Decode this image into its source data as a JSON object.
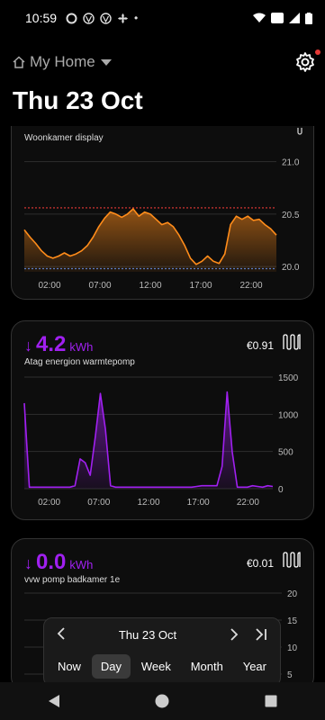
{
  "status_bar": {
    "time": "10:59"
  },
  "header": {
    "home_label": "My Home"
  },
  "page": {
    "title": "Thu 23 Oct"
  },
  "cards": [
    {
      "label": "Woonkamer display",
      "chart_data": {
        "type": "area",
        "x_ticks": [
          "02:00",
          "07:00",
          "12:00",
          "17:00",
          "22:00"
        ],
        "y_ticks": [
          "21.0",
          "20.5",
          "20.0"
        ],
        "ylim": [
          19.95,
          21.1
        ],
        "upper_limit": 20.56,
        "lower_limit": 19.98,
        "series": [
          {
            "values": [
              20.35,
              20.28,
              20.22,
              20.15,
              20.1,
              20.08,
              20.1,
              20.13,
              20.1,
              20.12,
              20.15,
              20.2,
              20.28,
              20.38,
              20.46,
              20.52,
              20.5,
              20.47,
              20.5,
              20.55,
              20.48,
              20.52,
              20.5,
              20.45,
              20.4,
              20.42,
              20.38,
              20.3,
              20.2,
              20.08,
              20.02,
              20.05,
              20.1,
              20.05,
              20.03,
              20.12,
              20.4,
              20.48,
              20.45,
              20.48,
              20.44,
              20.45,
              20.4,
              20.36,
              20.3
            ],
            "color": "#ff8c1a"
          }
        ]
      }
    },
    {
      "value": "4.2",
      "unit": "kWh",
      "label": "Atag energion warmtepomp",
      "cost": "€0.91",
      "chart_data": {
        "type": "area",
        "x_ticks": [
          "02:00",
          "07:00",
          "12:00",
          "17:00",
          "22:00"
        ],
        "y_ticks": [
          "1500",
          "1000",
          "500",
          "0"
        ],
        "ylim": [
          0,
          1500
        ],
        "series": [
          {
            "values": [
              1150,
              20,
              20,
              20,
              20,
              20,
              20,
              20,
              20,
              20,
              40,
              400,
              350,
              180,
              700,
              1280,
              800,
              40,
              20,
              20,
              20,
              20,
              20,
              20,
              20,
              20,
              20,
              20,
              20,
              20,
              20,
              20,
              20,
              20,
              30,
              40,
              40,
              40,
              40,
              300,
              1300,
              500,
              20,
              20,
              20,
              40,
              30,
              20,
              40,
              30
            ],
            "color": "#a020f0"
          }
        ]
      }
    },
    {
      "value": "0.0",
      "unit": "kWh",
      "label": "vvw pomp badkamer 1e",
      "cost": "€0.01",
      "chart_data": {
        "type": "area",
        "y_ticks": [
          "20",
          "15",
          "10",
          "5"
        ],
        "ylim": [
          0,
          20
        ],
        "series": []
      }
    }
  ],
  "date_nav": {
    "date": "Thu 23 Oct",
    "periods": [
      "Now",
      "Day",
      "Week",
      "Month",
      "Year"
    ],
    "active_period": "Day"
  }
}
